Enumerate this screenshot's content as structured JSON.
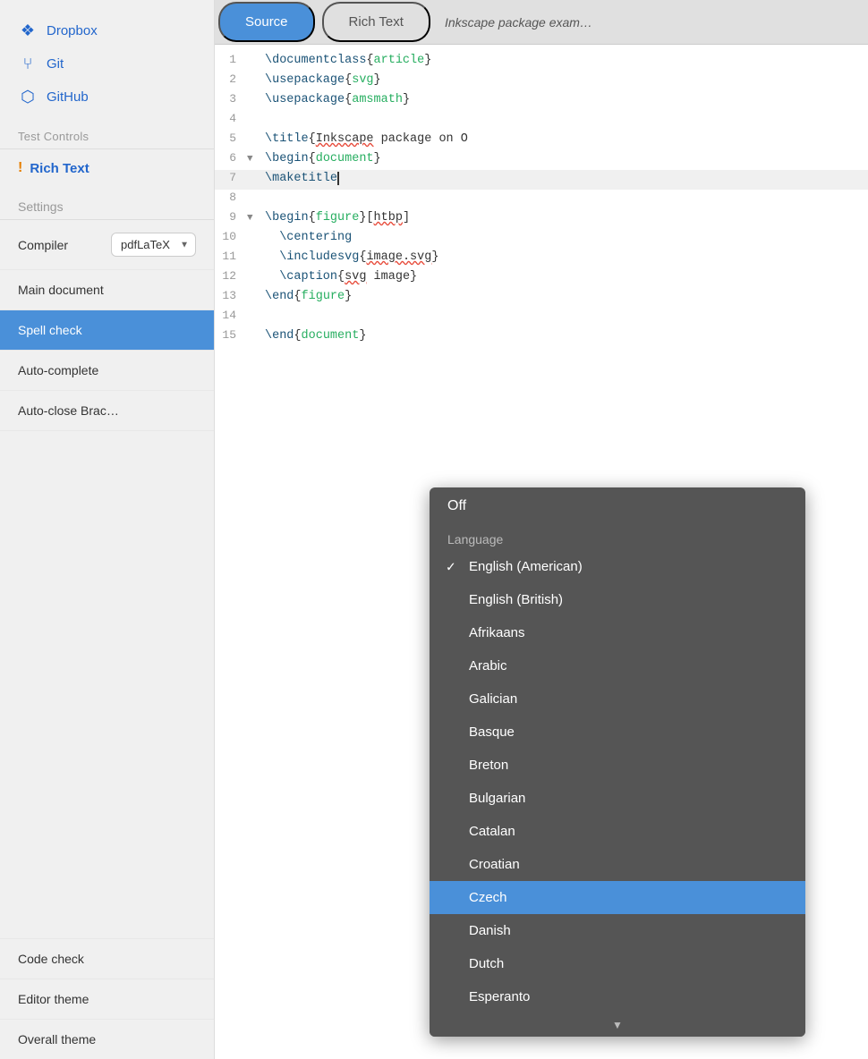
{
  "sidebar": {
    "nav_items": [
      {
        "icon": "📦",
        "label": "Dropbox",
        "icon_name": "dropbox-icon"
      },
      {
        "icon": "⑂",
        "label": "Git",
        "icon_name": "git-icon"
      },
      {
        "icon": "⬡",
        "label": "GitHub",
        "icon_name": "github-icon"
      }
    ],
    "test_controls_label": "Test Controls",
    "rich_text_label": "Rich Text",
    "settings_label": "Settings",
    "settings_rows": [
      {
        "label": "Compiler",
        "type": "select",
        "value": "pdfLaTeX"
      },
      {
        "label": "Main document",
        "type": "text",
        "value": ""
      },
      {
        "label": "Spell check",
        "type": "active",
        "value": ""
      },
      {
        "label": "Auto-complete",
        "type": "text",
        "value": ""
      },
      {
        "label": "Auto-close Brac…",
        "type": "text",
        "value": ""
      }
    ],
    "bottom_rows": [
      {
        "label": "Code check"
      },
      {
        "label": "Editor theme"
      },
      {
        "label": "Overall theme"
      }
    ]
  },
  "dropdown": {
    "off_label": "Off",
    "group_label": "Language",
    "items": [
      {
        "label": "English (American)",
        "checked": true,
        "selected": false
      },
      {
        "label": "English (British)",
        "checked": false,
        "selected": false
      },
      {
        "label": "Afrikaans",
        "checked": false,
        "selected": false
      },
      {
        "label": "Arabic",
        "checked": false,
        "selected": false
      },
      {
        "label": "Galician",
        "checked": false,
        "selected": false
      },
      {
        "label": "Basque",
        "checked": false,
        "selected": false
      },
      {
        "label": "Breton",
        "checked": false,
        "selected": false
      },
      {
        "label": "Bulgarian",
        "checked": false,
        "selected": false
      },
      {
        "label": "Catalan",
        "checked": false,
        "selected": false
      },
      {
        "label": "Croatian",
        "checked": false,
        "selected": false
      },
      {
        "label": "Czech",
        "checked": false,
        "selected": true
      },
      {
        "label": "Danish",
        "checked": false,
        "selected": false
      },
      {
        "label": "Dutch",
        "checked": false,
        "selected": false
      },
      {
        "label": "Esperanto",
        "checked": false,
        "selected": false
      }
    ],
    "scroll_arrow": "▼"
  },
  "editor": {
    "tabs": [
      {
        "label": "Source",
        "active": true
      },
      {
        "label": "Rich Text",
        "active": false
      }
    ],
    "title": "Inkscape package exam…",
    "lines": [
      {
        "num": "1",
        "collapse": "",
        "content": "\\documentclass{article}"
      },
      {
        "num": "2",
        "collapse": "",
        "content": "\\usepackage{svg}"
      },
      {
        "num": "3",
        "collapse": "",
        "content": "\\usepackage{amsmath}"
      },
      {
        "num": "4",
        "collapse": "",
        "content": ""
      },
      {
        "num": "5",
        "collapse": "",
        "content": "\\title{Inkscape package on O"
      },
      {
        "num": "6",
        "collapse": "▼",
        "content": "\\begin{document}"
      },
      {
        "num": "7",
        "collapse": "",
        "content": "\\maketitle",
        "highlight": true
      },
      {
        "num": "8",
        "collapse": "",
        "content": ""
      },
      {
        "num": "9",
        "collapse": "▼",
        "content": "\\begin{figure}[htbp]"
      },
      {
        "num": "10",
        "collapse": "",
        "content": "  \\centering"
      },
      {
        "num": "11",
        "collapse": "",
        "content": "  \\includesvg{image.svg}"
      },
      {
        "num": "12",
        "collapse": "",
        "content": "  \\caption{svg image}"
      },
      {
        "num": "13",
        "collapse": "",
        "content": "\\end{figure}"
      },
      {
        "num": "14",
        "collapse": "",
        "content": ""
      },
      {
        "num": "15",
        "collapse": "",
        "content": "\\end{document}"
      }
    ]
  }
}
